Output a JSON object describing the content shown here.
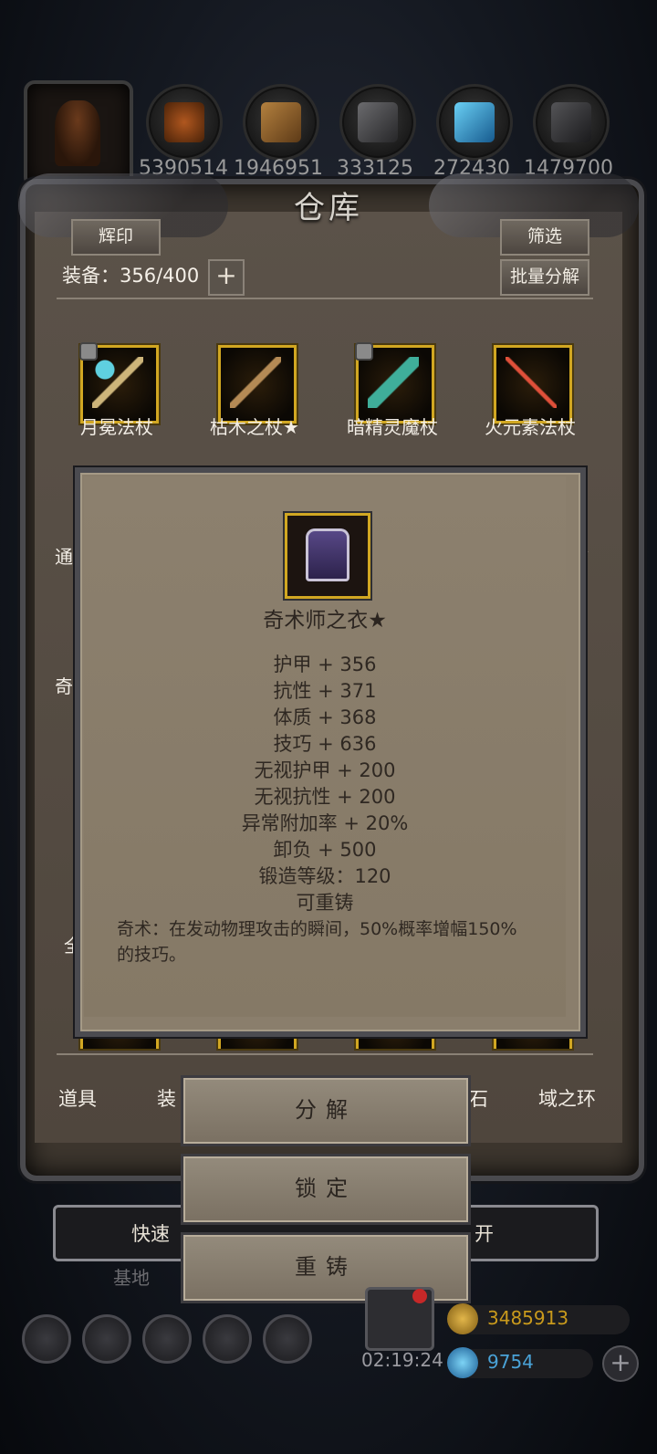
{
  "resources": [
    {
      "icon": "character-portrait-icon"
    },
    {
      "icon": "meat-icon",
      "count": "5390514"
    },
    {
      "icon": "wood-plank-icon",
      "count": "1946951"
    },
    {
      "icon": "iron-ingot-icon",
      "count": "333125"
    },
    {
      "icon": "blue-crystal-icon",
      "count": "272430"
    },
    {
      "icon": "dark-ore-icon",
      "count": "1479700"
    }
  ],
  "panel": {
    "title": "仓库",
    "emblem_button": "辉印",
    "filter_button": "筛选",
    "batch_decompose_button": "批量分解",
    "equip_label": "装备：356/400",
    "plus": "+"
  },
  "items_row1": [
    {
      "name": "月冕法杖",
      "locked": true
    },
    {
      "name": "枯木之杖★",
      "locked": false
    },
    {
      "name": "暗精灵魔杖",
      "locked": true
    },
    {
      "name": "火元素法杖",
      "locked": false
    }
  ],
  "side_fragments": {
    "left1": "通",
    "left2": "奇",
    "left3": "全",
    "right_star": "★"
  },
  "tabs": {
    "items": "道具",
    "equip": "装",
    "stone": "石",
    "ring": "域之环"
  },
  "quick_bar": {
    "left": "快速",
    "right": "开",
    "below": "基地"
  },
  "tooltip": {
    "name": "奇术师之衣★",
    "stats": [
      "护甲 + 356",
      "抗性 + 371",
      "体质 + 368",
      "技巧 + 636",
      "无视护甲 + 200",
      "无视抗性 + 200",
      "异常附加率 + 20%",
      "卸负 + 500",
      "锻造等级：120",
      "可重铸"
    ],
    "description": "奇术：在发动物理攻击的瞬间，50%概率增幅150%的技巧。"
  },
  "actions": {
    "decompose": "分解",
    "lock": "锁定",
    "reforge": "重铸"
  },
  "hud": {
    "timer": "02:19:24",
    "gold": "3485913",
    "gems": "9754",
    "plus": "+"
  },
  "colors": {
    "item_border": "#d1a722",
    "tooltip_bg": "#8a7e6c",
    "gold_text": "#c99a1c",
    "gem_text": "#4aa3d8"
  }
}
